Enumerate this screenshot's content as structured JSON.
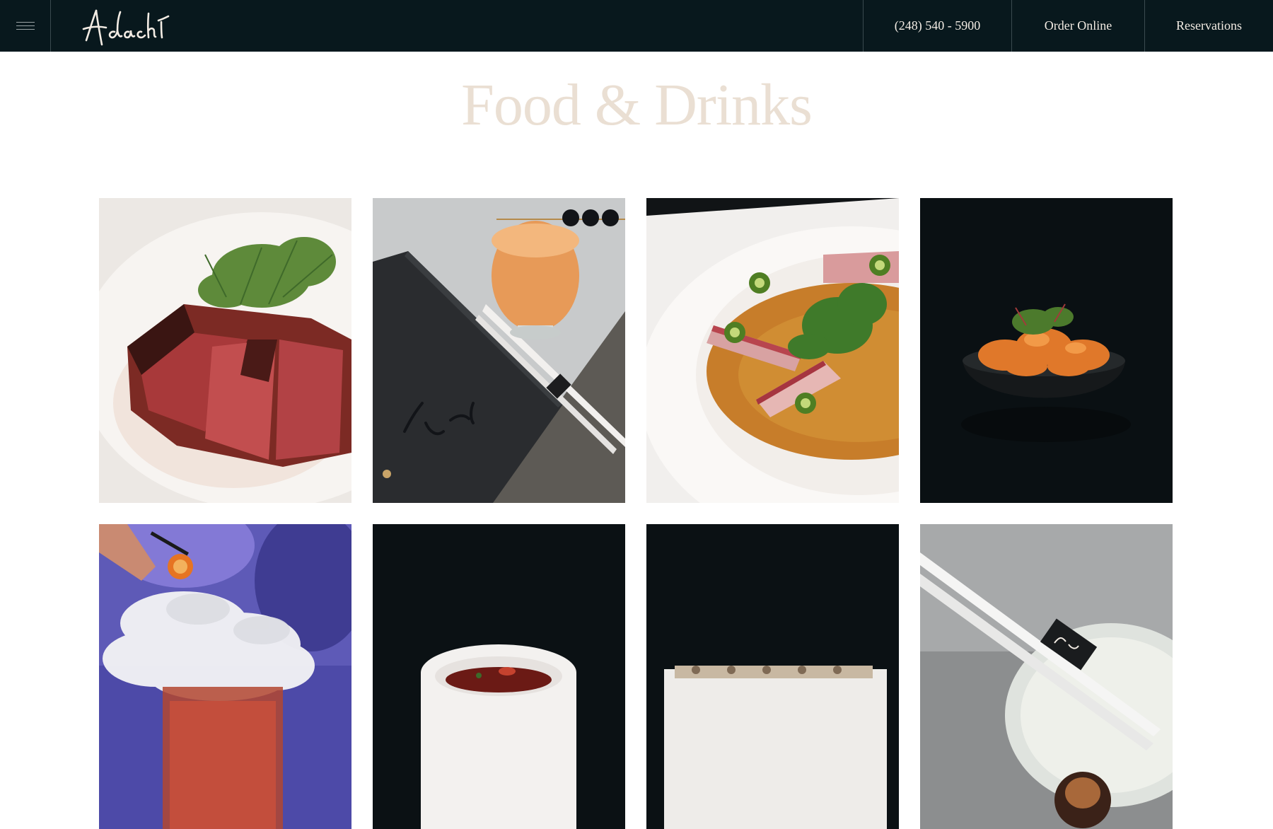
{
  "header": {
    "menu_icon": "hamburger-icon",
    "logo_text": "Adachi",
    "nav": {
      "phone": "(248) 540 - 5900",
      "order": "Order Online",
      "reservations": "Reservations"
    }
  },
  "main": {
    "title": "Food & Drinks"
  },
  "colors": {
    "header_bg": "#08181d",
    "title": "#eadfd3",
    "nav_text": "#f3ece4"
  }
}
